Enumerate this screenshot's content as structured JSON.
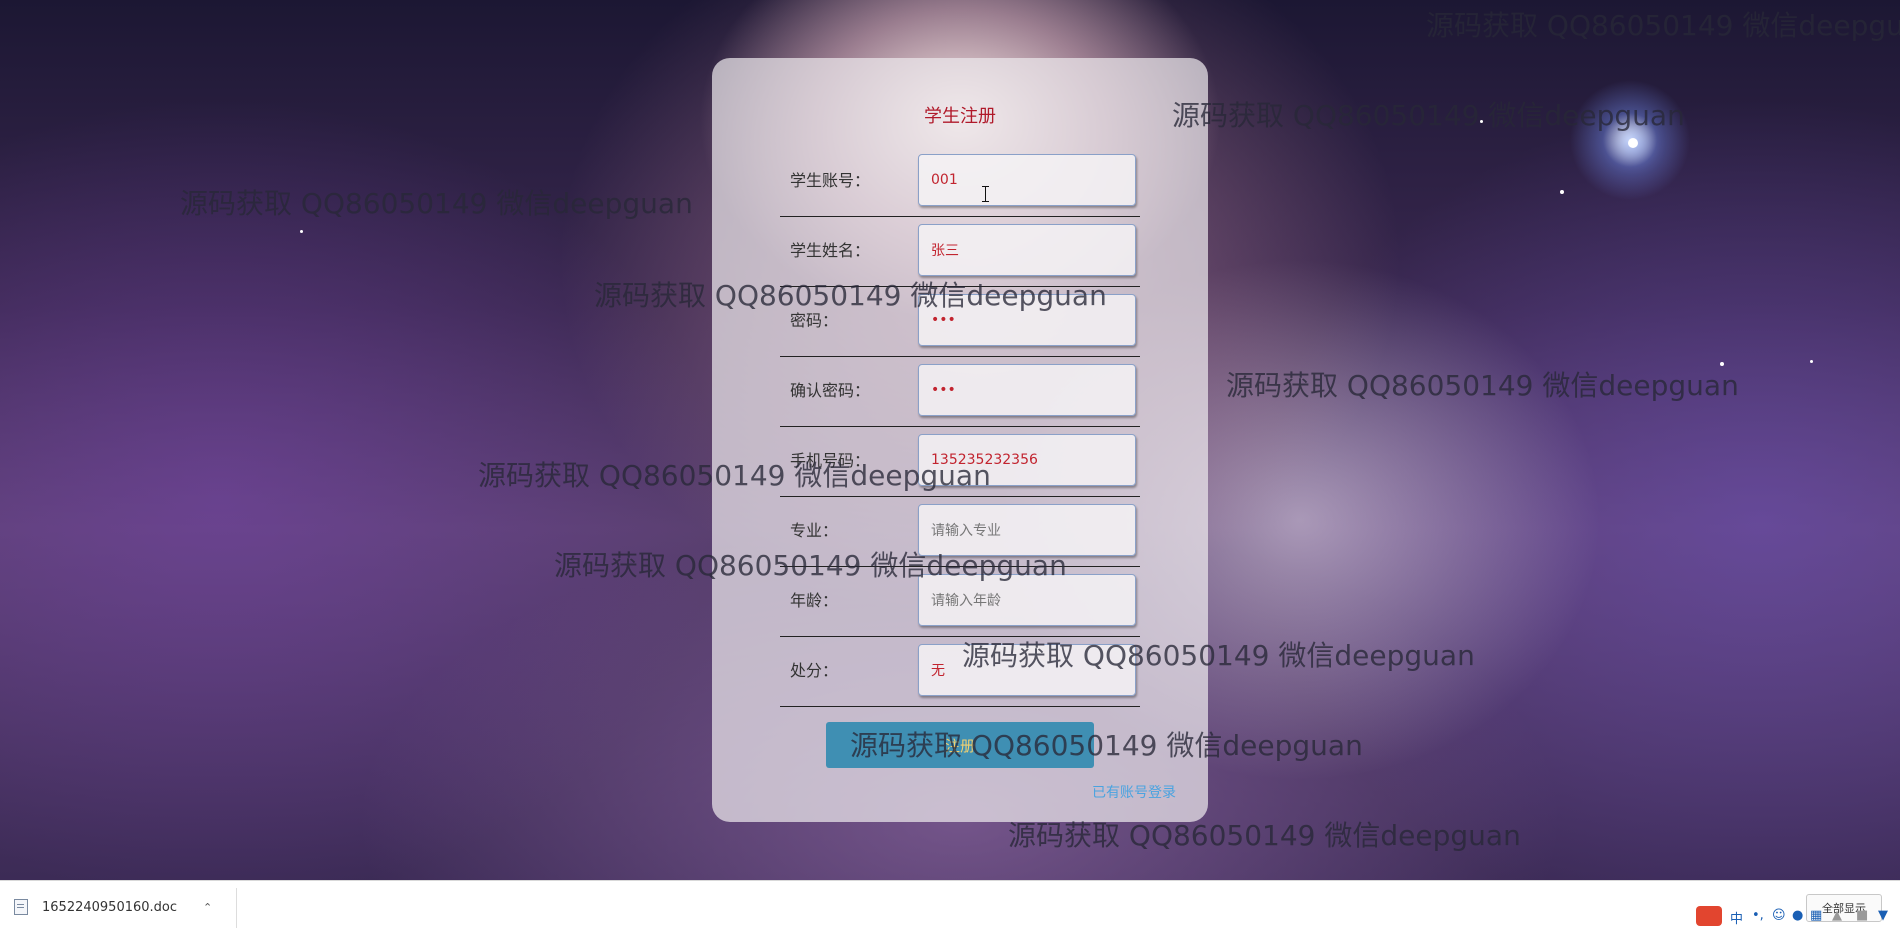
{
  "form": {
    "title": "学生注册",
    "fields": [
      {
        "label": "学生账号：",
        "value": "001",
        "placeholder": ""
      },
      {
        "label": "学生姓名：",
        "value": "张三",
        "placeholder": ""
      },
      {
        "label": "密码：",
        "value": "•••",
        "placeholder": ""
      },
      {
        "label": "确认密码：",
        "value": "•••",
        "placeholder": ""
      },
      {
        "label": "手机号码：",
        "value": "135235232356",
        "placeholder": ""
      },
      {
        "label": "专业：",
        "value": "",
        "placeholder": "请输入专业"
      },
      {
        "label": "年龄：",
        "value": "",
        "placeholder": "请输入年龄"
      },
      {
        "label": "处分：",
        "value": "无",
        "placeholder": ""
      }
    ],
    "submit_label": "注册",
    "login_link": "已有账号登录"
  },
  "watermark": "源码获取 QQ86050149 微信deepguan",
  "download_bar": {
    "file_name": "1652240950160.doc",
    "show_all_label": "全部显示"
  },
  "tray": {
    "ime_label": "中"
  },
  "colors": {
    "title": "#b0192a",
    "value_text": "#c2242f",
    "button": "#3f8fb3",
    "link": "#4aa3e0"
  }
}
